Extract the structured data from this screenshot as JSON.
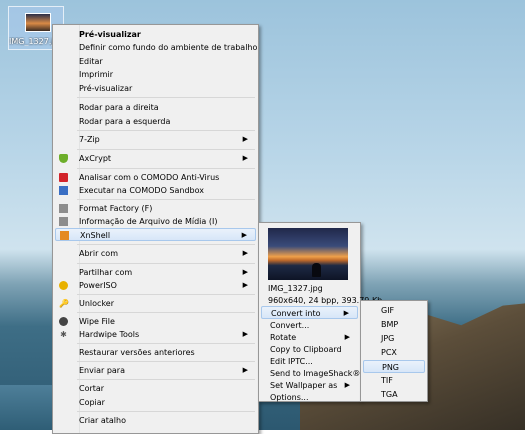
{
  "desktop_icon": {
    "label": "IMG_1327.jpg"
  },
  "context_menu": {
    "items": [
      {
        "label": "Pré-visualizar",
        "bold": true
      },
      {
        "label": "Definir como fundo do ambiente de trabalho"
      },
      {
        "label": "Editar"
      },
      {
        "label": "Imprimir"
      },
      {
        "label": "Pré-visualizar"
      },
      {
        "label": "Rodar para a direita"
      },
      {
        "label": "Rodar para a esquerda"
      },
      {
        "label": "7-Zip",
        "submenu": true
      },
      {
        "label": "AxCrypt",
        "submenu": true,
        "icon": "axcrypt-icon"
      },
      {
        "label": "Analisar com o COMODO Anti-Virus",
        "icon": "comodo-antivirus-icon"
      },
      {
        "label": "Executar na COMODO Sandbox",
        "icon": "comodo-sandbox-icon"
      },
      {
        "label": "Format Factory (F)",
        "icon": "format-factory-icon"
      },
      {
        "label": "Informação de Arquivo de Mídia (I)",
        "icon": "media-info-icon"
      },
      {
        "label": "XnShell",
        "submenu": true,
        "icon": "xnshell-icon",
        "highlighted": true
      },
      {
        "label": "Abrir com",
        "submenu": true
      },
      {
        "label": "Partilhar com",
        "submenu": true
      },
      {
        "label": "PowerISO",
        "submenu": true,
        "icon": "poweriso-icon"
      },
      {
        "label": "Unlocker",
        "icon": "unlocker-icon"
      },
      {
        "label": "Wipe File",
        "icon": "wipe-file-icon"
      },
      {
        "label": "Hardwipe Tools",
        "submenu": true,
        "icon": "hardwipe-icon"
      },
      {
        "label": "Restaurar versões anteriores"
      },
      {
        "label": "Enviar para",
        "submenu": true
      },
      {
        "label": "Cortar"
      },
      {
        "label": "Copiar"
      },
      {
        "label": "Criar atalho"
      }
    ]
  },
  "xnshell_menu": {
    "filename": "IMG_1327.jpg",
    "details": "960x640, 24 bpp, 393.79 Kb",
    "items": [
      {
        "label": "Convert into",
        "submenu": true,
        "highlighted": true
      },
      {
        "label": "Convert..."
      },
      {
        "label": "Rotate",
        "submenu": true
      },
      {
        "label": "Copy to Clipboard"
      },
      {
        "label": "Edit IPTC..."
      },
      {
        "label": "Send to ImageShack®"
      },
      {
        "label": "Set Wallpaper as",
        "submenu": true
      },
      {
        "label": "Options..."
      }
    ]
  },
  "convert_menu": {
    "items": [
      {
        "label": "GIF"
      },
      {
        "label": "BMP"
      },
      {
        "label": "JPG"
      },
      {
        "label": "PCX"
      },
      {
        "label": "PNG",
        "highlighted": true
      },
      {
        "label": "TIF"
      },
      {
        "label": "TGA"
      }
    ]
  },
  "icons": {
    "submenu_arrow": "▶"
  }
}
